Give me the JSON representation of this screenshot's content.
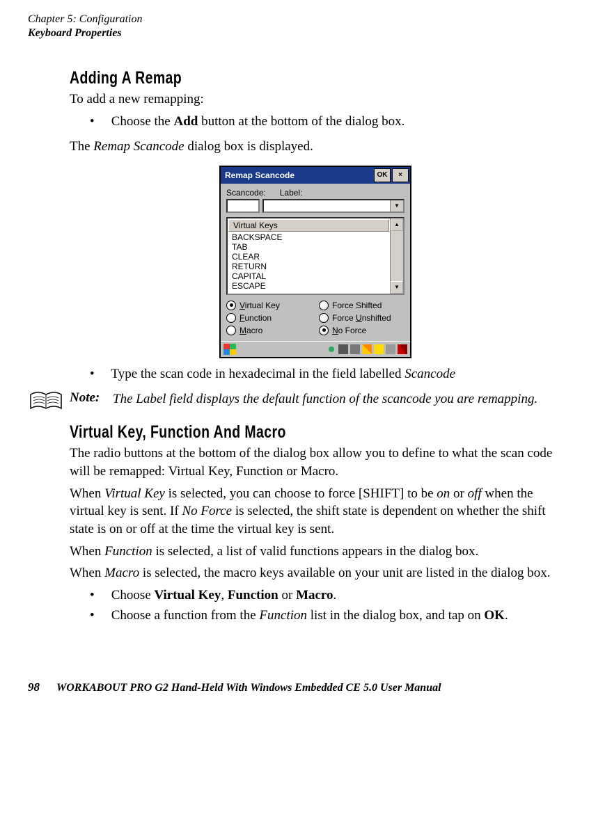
{
  "running_head": {
    "line1": "Chapter 5: Configuration",
    "line2": "Keyboard Properties"
  },
  "section1": {
    "title": "Adding A Remap",
    "intro": "To add a new remapping:",
    "bullet1_pre": "Choose the ",
    "bullet1_bold": "Add",
    "bullet1_post": " button at the bottom of the dialog box.",
    "after1_pre": "The ",
    "after1_ital": "Remap Scancode",
    "after1_post": " dialog box is displayed.",
    "bullet2_pre": "Type the scan code in hexadecimal in the field labelled ",
    "bullet2_ital": "Scancode"
  },
  "note": {
    "label": "Note:",
    "text": "The Label field displays the default function of the scancode you are remapping."
  },
  "section2": {
    "title": "Virtual Key, Function And Macro",
    "p1": "The radio buttons at the bottom of the dialog box allow you to define to what the scan code will be remapped: Virtual Key, Function or Macro.",
    "p2_a": "When ",
    "p2_vk": "Virtual Key",
    "p2_b": " is selected, you can choose to force [SHIFT] to be ",
    "p2_on": "on",
    "p2_c": " or ",
    "p2_off": "off",
    "p2_d": " when the virtual key is sent. If ",
    "p2_nf": "No Force",
    "p2_e": " is selected, the shift state is dependent on whether the shift state is on or off at the time the virtual key is sent.",
    "p3_a": "When ",
    "p3_fn": "Function",
    "p3_b": " is selected, a list of valid functions appears in the dialog box.",
    "p4_a": "When ",
    "p4_mc": "Macro",
    "p4_b": " is selected, the macro keys available on your unit are listed in the dialog box.",
    "bullet1_pre": "Choose ",
    "bullet1_b1": "Virtual Key",
    "bullet1_sep1": ", ",
    "bullet1_b2": "Function",
    "bullet1_sep2": " or ",
    "bullet1_b3": "Macro",
    "bullet1_post": ".",
    "bullet2_pre": "Choose a function from the ",
    "bullet2_ital": "Function",
    "bullet2_mid": " list in the dialog box, and tap on ",
    "bullet2_bold": "OK",
    "bullet2_post": "."
  },
  "dialog": {
    "title": "Remap Scancode",
    "ok": "OK",
    "close": "×",
    "label_scancode": "Scancode:",
    "label_label": "Label:",
    "list_header": "Virtual Keys",
    "items": [
      "BACKSPACE",
      "TAB",
      "CLEAR",
      "RETURN",
      "CAPITAL",
      "ESCAPE"
    ],
    "radios": {
      "vk_u": "V",
      "vk_rest": "irtual Key",
      "fn_u": "F",
      "fn_rest": "unction",
      "mc_u": "M",
      "mc_rest": "acro",
      "fs_full": "Force Shifted",
      "fu_pre": "Force ",
      "fu_u": "U",
      "fu_rest": "nshifted",
      "nf_u": "N",
      "nf_rest": "o Force"
    }
  },
  "footer": {
    "page": "98",
    "title": "WORKABOUT PRO G2 Hand-Held With Windows Embedded CE 5.0 User Manual"
  }
}
